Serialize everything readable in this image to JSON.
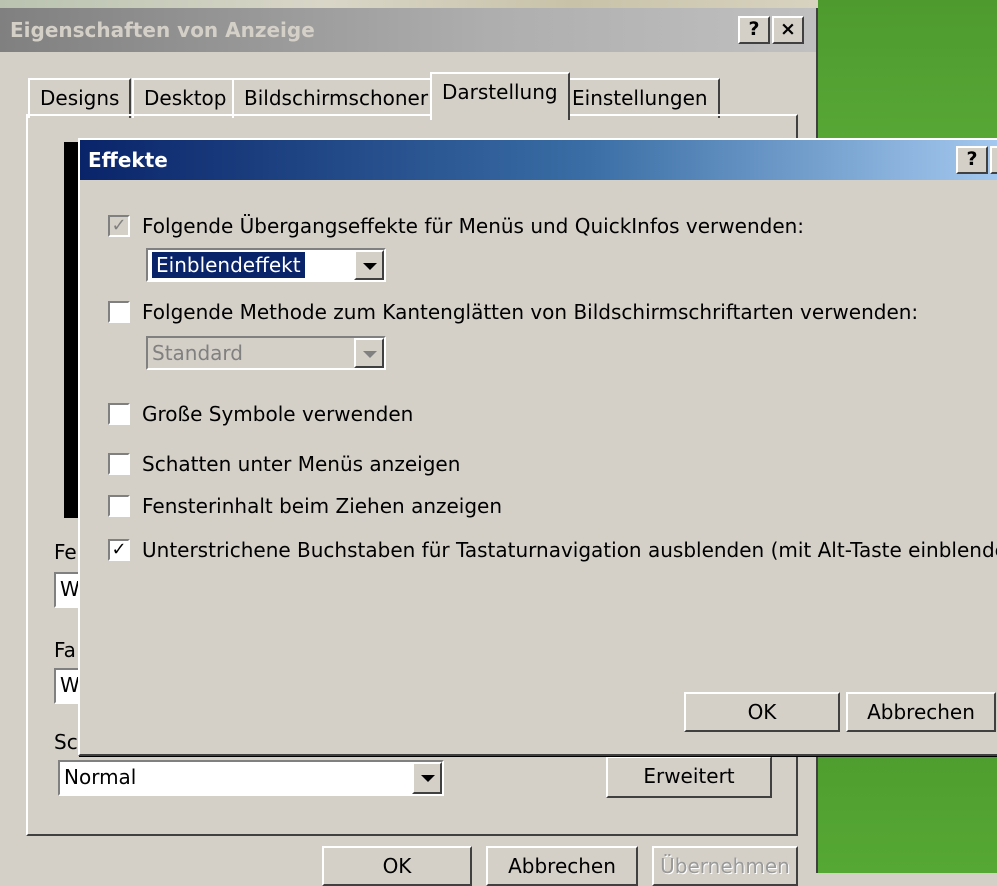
{
  "back_window": {
    "title": "Eigenschaften von Anzeige",
    "help_button": "?",
    "close_button": "×",
    "tabs": [
      {
        "label": "Designs"
      },
      {
        "label": "Desktop"
      },
      {
        "label": "Bildschirmschoner"
      },
      {
        "label": "Darstellung",
        "active": true
      },
      {
        "label": "Einstellungen"
      }
    ],
    "partial_labels": [
      "Fe",
      "Fa",
      "Sc"
    ],
    "partial_inputs": [
      "W",
      "W"
    ],
    "font_size_select": {
      "value": "Normal"
    },
    "advanced_button": "Erweitert",
    "footer": {
      "ok": "OK",
      "cancel": "Abbrechen",
      "apply": "Übernehmen"
    }
  },
  "effects_dialog": {
    "title": "Effekte",
    "help_button": "?",
    "close_button": "×",
    "options": [
      {
        "label": "Folgende Übergangseffekte für Menüs und QuickInfos verwenden:",
        "checked": true,
        "disabled_check": true
      },
      {
        "label": "Folgende Methode zum Kantenglätten von Bildschirmschriftarten verwenden:",
        "checked": false
      },
      {
        "label": "Große Symbole verwenden",
        "checked": false
      },
      {
        "label": "Schatten unter Menüs anzeigen",
        "checked": false
      },
      {
        "label": "Fensterinhalt beim Ziehen anzeigen",
        "checked": false
      },
      {
        "label": "Unterstrichene Buchstaben für Tastaturnavigation ausblenden (mit Alt-Taste einblenden)",
        "checked": true
      }
    ],
    "transition_select": {
      "value": "Einblendeffekt"
    },
    "smoothing_select": {
      "value": "Standard"
    },
    "ok": "OK",
    "cancel": "Abbrechen",
    "check_mark": "✓"
  },
  "colors": {
    "face": "#d4d0c8",
    "active_title": "#0a246a",
    "desktop_green": "#4e9a2e"
  }
}
